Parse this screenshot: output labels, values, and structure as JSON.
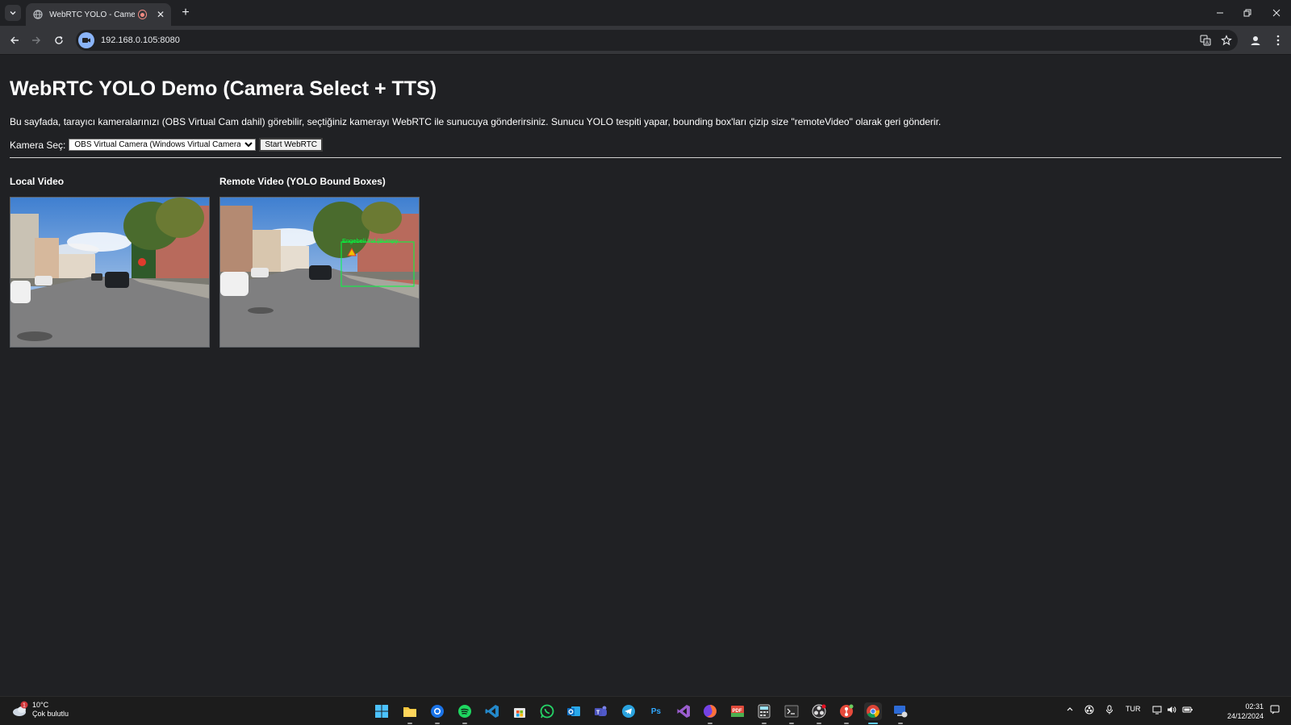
{
  "browser": {
    "tab_title": "WebRTC YOLO - Camera Se",
    "url": "192.168.0.105:8080"
  },
  "page": {
    "heading": "WebRTC YOLO Demo (Camera Select + TTS)",
    "description": "Bu sayfada, tarayıcı kameralarınızı (OBS Virtual Cam dahil) görebilir, seçtiğiniz kamerayı WebRTC ile sunucuya gönderirsiniz. Sunucu YOLO tespiti yapar, bounding box'ları çizip size \"remoteVideo\" olarak geri gönderir.",
    "camera_label": "Kamera Seç:",
    "camera_selected": "OBS Virtual Camera (Windows Virtual Camera)",
    "start_button": "Start WebRTC",
    "local_video_title": "Local Video",
    "remote_video_title": "Remote Video (YOLO Bound Boxes)",
    "detection_label": "Engebeli Yol (Bumpy"
  },
  "taskbar": {
    "weather_temp": "10°C",
    "weather_desc": "Çok bulutlu",
    "language": "TUR",
    "time": "02:31",
    "date": "24/12/2024",
    "weather_badge": "1",
    "pdf_badge": "PDF",
    "ps_label": "Ps"
  }
}
